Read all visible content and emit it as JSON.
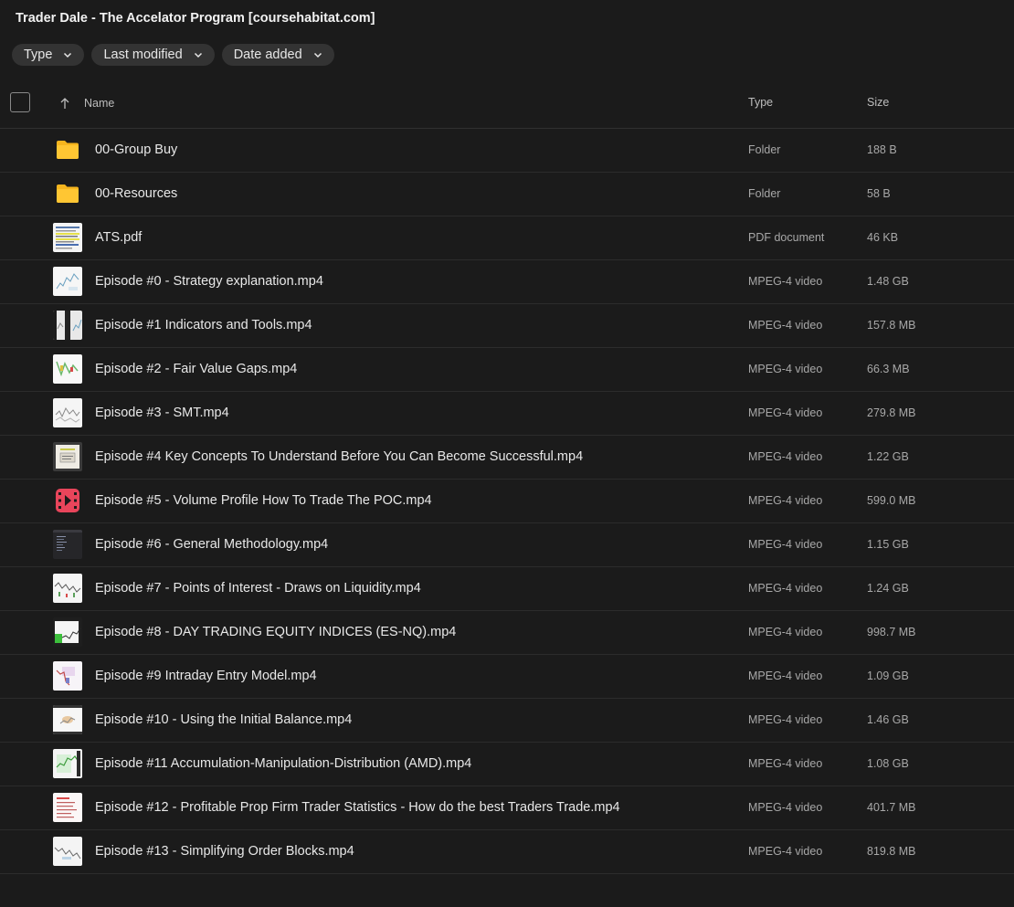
{
  "title": "Trader Dale - The Accelator Program [coursehabitat.com]",
  "filters": [
    {
      "label": "Type"
    },
    {
      "label": "Last modified"
    },
    {
      "label": "Date added"
    }
  ],
  "columns": {
    "name": "Name",
    "type": "Type",
    "size": "Size"
  },
  "files": [
    {
      "name": "00-Group Buy",
      "type": "Folder",
      "size": "188 B",
      "icon": "folder-icon"
    },
    {
      "name": "00-Resources",
      "type": "Folder",
      "size": "58 B",
      "icon": "folder-icon"
    },
    {
      "name": "ATS.pdf",
      "type": "PDF document",
      "size": "46 KB",
      "icon": "pdf-thumbnail"
    },
    {
      "name": "Episode #0 - Strategy explanation.mp4",
      "type": "MPEG-4 video",
      "size": "1.48 GB",
      "icon": "video-thumbnail"
    },
    {
      "name": "Episode #1 Indicators and Tools.mp4",
      "type": "MPEG-4 video",
      "size": "157.8 MB",
      "icon": "video-thumbnail"
    },
    {
      "name": "Episode #2 - Fair Value Gaps.mp4",
      "type": "MPEG-4 video",
      "size": "66.3 MB",
      "icon": "video-thumbnail"
    },
    {
      "name": "Episode #3 - SMT.mp4",
      "type": "MPEG-4 video",
      "size": "279.8 MB",
      "icon": "video-thumbnail"
    },
    {
      "name": "Episode #4 Key Concepts To Understand Before You Can Become Successful.mp4",
      "type": "MPEG-4 video",
      "size": "1.22 GB",
      "icon": "video-thumbnail"
    },
    {
      "name": "Episode #5 - Volume Profile How To Trade The POC.mp4",
      "type": "MPEG-4 video",
      "size": "599.0 MB",
      "icon": "video-file-icon"
    },
    {
      "name": "Episode #6 - General Methodology.mp4",
      "type": "MPEG-4 video",
      "size": "1.15 GB",
      "icon": "video-thumbnail"
    },
    {
      "name": "Episode #7 - Points of Interest - Draws on Liquidity.mp4",
      "type": "MPEG-4 video",
      "size": "1.24 GB",
      "icon": "video-thumbnail"
    },
    {
      "name": "Episode #8 - DAY TRADING EQUITY INDICES (ES-NQ).mp4",
      "type": "MPEG-4 video",
      "size": "998.7 MB",
      "icon": "video-thumbnail"
    },
    {
      "name": "Episode #9 Intraday Entry Model.mp4",
      "type": "MPEG-4 video",
      "size": "1.09 GB",
      "icon": "video-thumbnail"
    },
    {
      "name": "Episode #10 - Using the Initial Balance.mp4",
      "type": "MPEG-4 video",
      "size": "1.46 GB",
      "icon": "video-thumbnail"
    },
    {
      "name": "Episode #11 Accumulation-Manipulation-Distribution (AMD).mp4",
      "type": "MPEG-4 video",
      "size": "1.08 GB",
      "icon": "video-thumbnail"
    },
    {
      "name": "Episode #12 - Profitable Prop Firm Trader Statistics - How do the best Traders Trade.mp4",
      "type": "MPEG-4 video",
      "size": "401.7 MB",
      "icon": "video-thumbnail"
    },
    {
      "name": "Episode #13 - Simplifying Order Blocks.mp4",
      "type": "MPEG-4 video",
      "size": "819.8 MB",
      "icon": "video-thumbnail"
    }
  ],
  "colors": {
    "background": "#1b1b1b",
    "chip": "#333333",
    "folder": "#f6b51e",
    "video_icon": "#e8455b"
  }
}
